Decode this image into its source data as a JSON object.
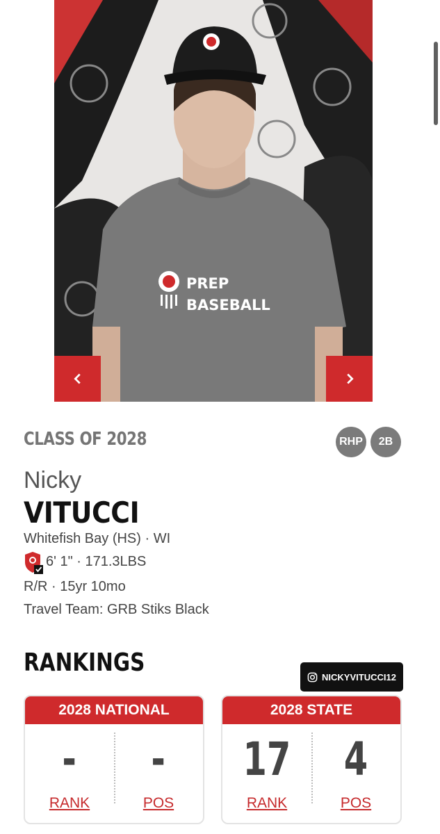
{
  "carousel": {
    "prev_icon": "chevron-left-icon",
    "next_icon": "chevron-right-icon",
    "accent": "#cf2a2c",
    "shirt_line1": "PREP",
    "shirt_line2": "BASEBALL"
  },
  "profile": {
    "class_of": "CLASS OF 2028",
    "positions": [
      "RHP",
      "2B"
    ],
    "first_name": "Nicky",
    "last_name": "VITUCCI",
    "school": "Whitefish Bay (HS) · WI",
    "size": "6' 1\" · 171.3LBS",
    "bats_age": "R/R · 15yr 10mo",
    "travel_team": "Travel Team: GRB Stiks Black"
  },
  "rankings": {
    "title": "RANKINGS",
    "instagram": "NICKYVITUCCI12",
    "national": {
      "title": "2028 NATIONAL",
      "rank": "-",
      "pos": "-",
      "rank_label": "RANK",
      "pos_label": "POS"
    },
    "state": {
      "title": "2028 STATE",
      "rank": "17",
      "pos": "4",
      "rank_label": "RANK",
      "pos_label": "POS"
    }
  }
}
